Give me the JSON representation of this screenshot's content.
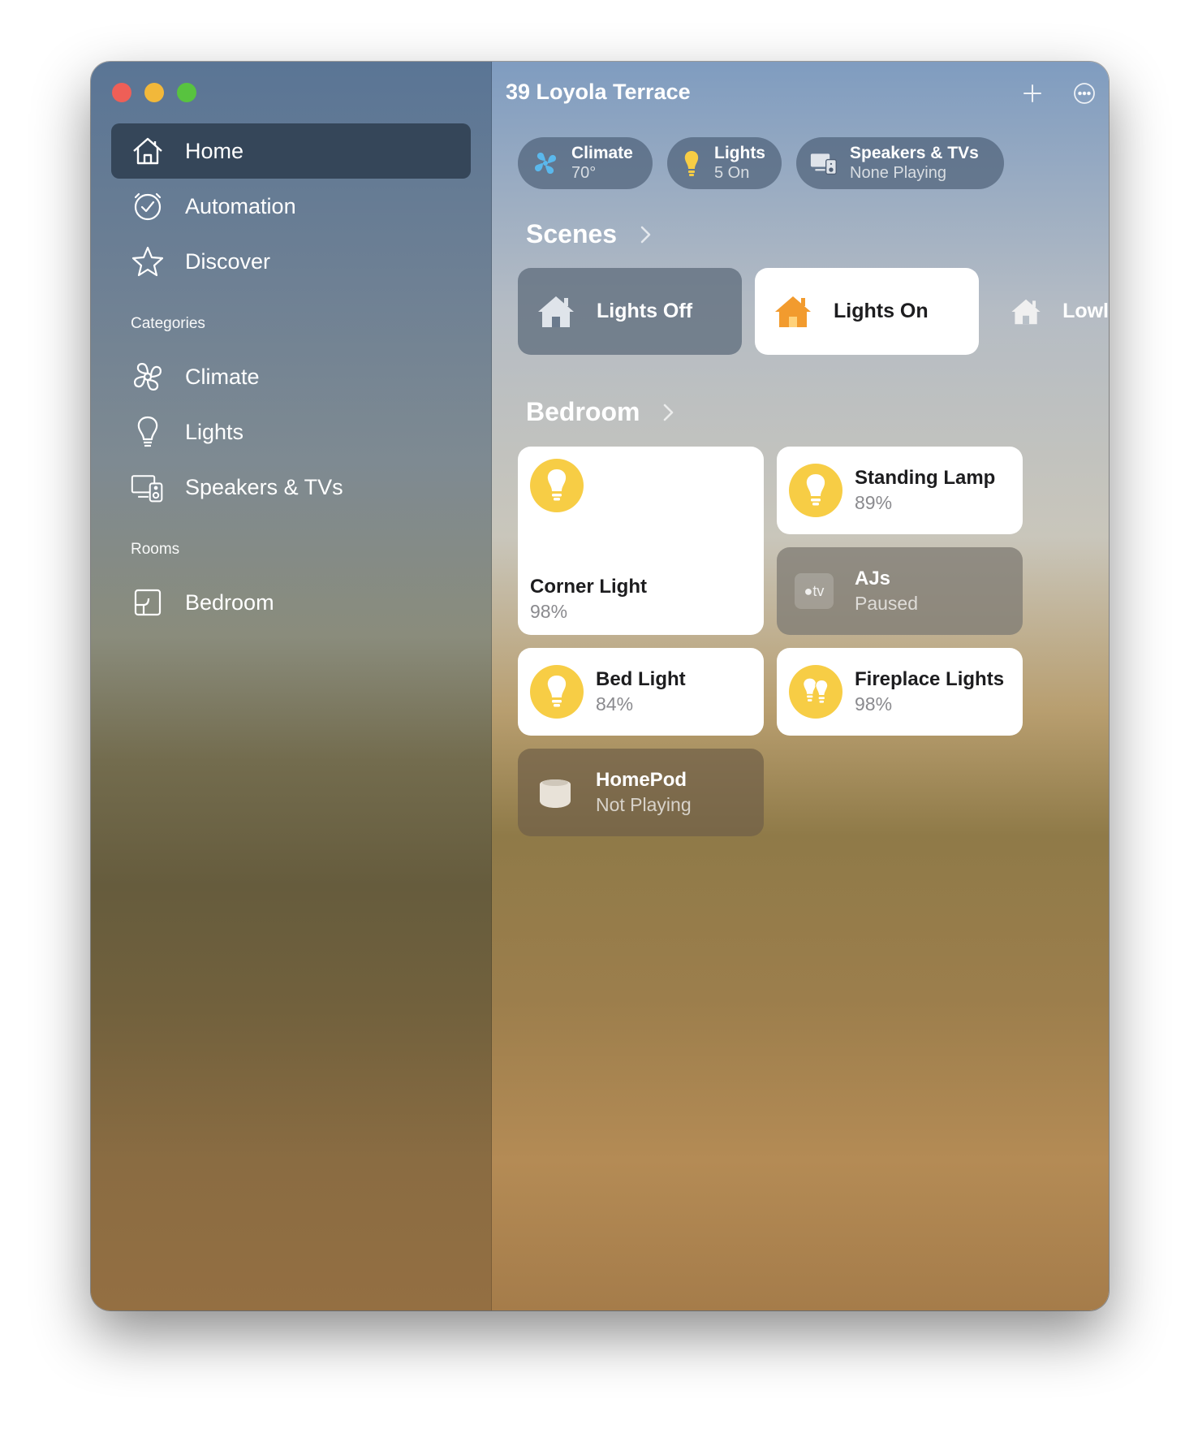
{
  "window": {
    "title": "39 Loyola Terrace"
  },
  "sidebar": {
    "items": [
      {
        "label": "Home",
        "icon": "house-icon"
      },
      {
        "label": "Automation",
        "icon": "clock-check-icon"
      },
      {
        "label": "Discover",
        "icon": "star-icon"
      }
    ],
    "categories_header": "Categories",
    "categories": [
      {
        "label": "Climate",
        "icon": "fan-icon"
      },
      {
        "label": "Lights",
        "icon": "lightbulb-icon"
      },
      {
        "label": "Speakers & TVs",
        "icon": "speaker-tv-icon"
      }
    ],
    "rooms_header": "Rooms",
    "rooms": [
      {
        "label": "Bedroom",
        "icon": "room-icon"
      }
    ]
  },
  "status_pills": [
    {
      "title": "Climate",
      "subtitle": "70°",
      "icon": "fan-icon"
    },
    {
      "title": "Lights",
      "subtitle": "5 On",
      "icon": "lightbulb-icon"
    },
    {
      "title": "Speakers & TVs",
      "subtitle": "None Playing",
      "icon": "speaker-tv-icon"
    }
  ],
  "scenes": {
    "header": "Scenes",
    "items": [
      {
        "label": "Lights Off",
        "state": "inactive"
      },
      {
        "label": "Lights On",
        "state": "active"
      },
      {
        "label": "Lowl",
        "state": "inactive"
      }
    ]
  },
  "bedroom": {
    "header": "Bedroom",
    "accessories": [
      {
        "name": "Corner Light",
        "status": "98%",
        "icon": "lightbulb-icon"
      },
      {
        "name": "Standing Lamp",
        "status": "89%",
        "icon": "lightbulb-icon"
      },
      {
        "name": "AJs",
        "status": "Paused",
        "icon": "apple-tv-icon",
        "badge": "tv"
      },
      {
        "name": "Bed Light",
        "status": "84%",
        "icon": "lightbulb-icon"
      },
      {
        "name": "Fireplace Lights",
        "status": "98%",
        "icon": "double-lightbulb-icon"
      },
      {
        "name": "HomePod",
        "status": "Not Playing",
        "icon": "homepod-icon"
      }
    ]
  },
  "colors": {
    "accent_bulb": "#f7cd45",
    "scene_active_icon": "#f29b2e",
    "sidebar_selected": "#354659"
  }
}
